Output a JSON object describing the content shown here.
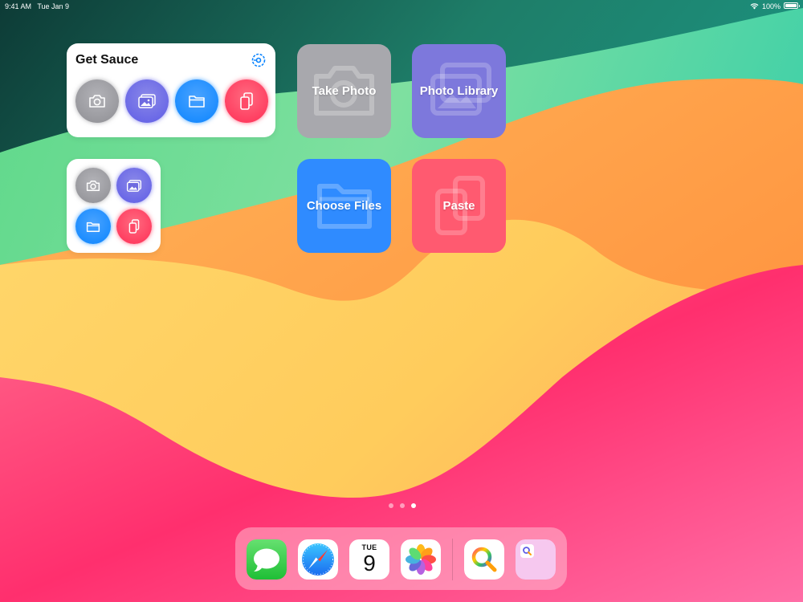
{
  "status_bar": {
    "time": "9:41 AM",
    "date": "Tue Jan 9",
    "battery": "100%"
  },
  "widget_large": {
    "title": "Get Sauce",
    "buttons": [
      {
        "icon": "camera-icon",
        "color": "#8e8e93"
      },
      {
        "icon": "photos-icon",
        "color": "#5e5ce6"
      },
      {
        "icon": "folder-icon",
        "color": "#0a84ff"
      },
      {
        "icon": "paste-icon",
        "color": "#ff2d55"
      }
    ]
  },
  "widget_small": {
    "buttons": [
      {
        "icon": "camera-icon",
        "color": "#8e8e93"
      },
      {
        "icon": "photos-icon",
        "color": "#5e5ce6"
      },
      {
        "icon": "folder-icon",
        "color": "#0a84ff"
      },
      {
        "icon": "paste-icon",
        "color": "#ff2d55"
      }
    ]
  },
  "tiles": [
    {
      "label": "Take Photo",
      "icon": "camera-icon",
      "color": "#a8a8ad"
    },
    {
      "label": "Photo Library",
      "icon": "photos-icon",
      "color": "#7d78dc"
    },
    {
      "label": "Choose Files",
      "icon": "folder-icon",
      "color": "#2f8bff"
    },
    {
      "label": "Paste",
      "icon": "paste-icon",
      "color": "#ff5a70"
    }
  ],
  "page_indicator": {
    "pages": 3,
    "current": 3
  },
  "dock": {
    "calendar": {
      "weekday": "TUE",
      "day": "9"
    },
    "apps": [
      "messages-icon",
      "safari-icon",
      "calendar-icon",
      "photos-app-icon",
      "magnifier-app-icon",
      "folder-app-icon"
    ]
  }
}
